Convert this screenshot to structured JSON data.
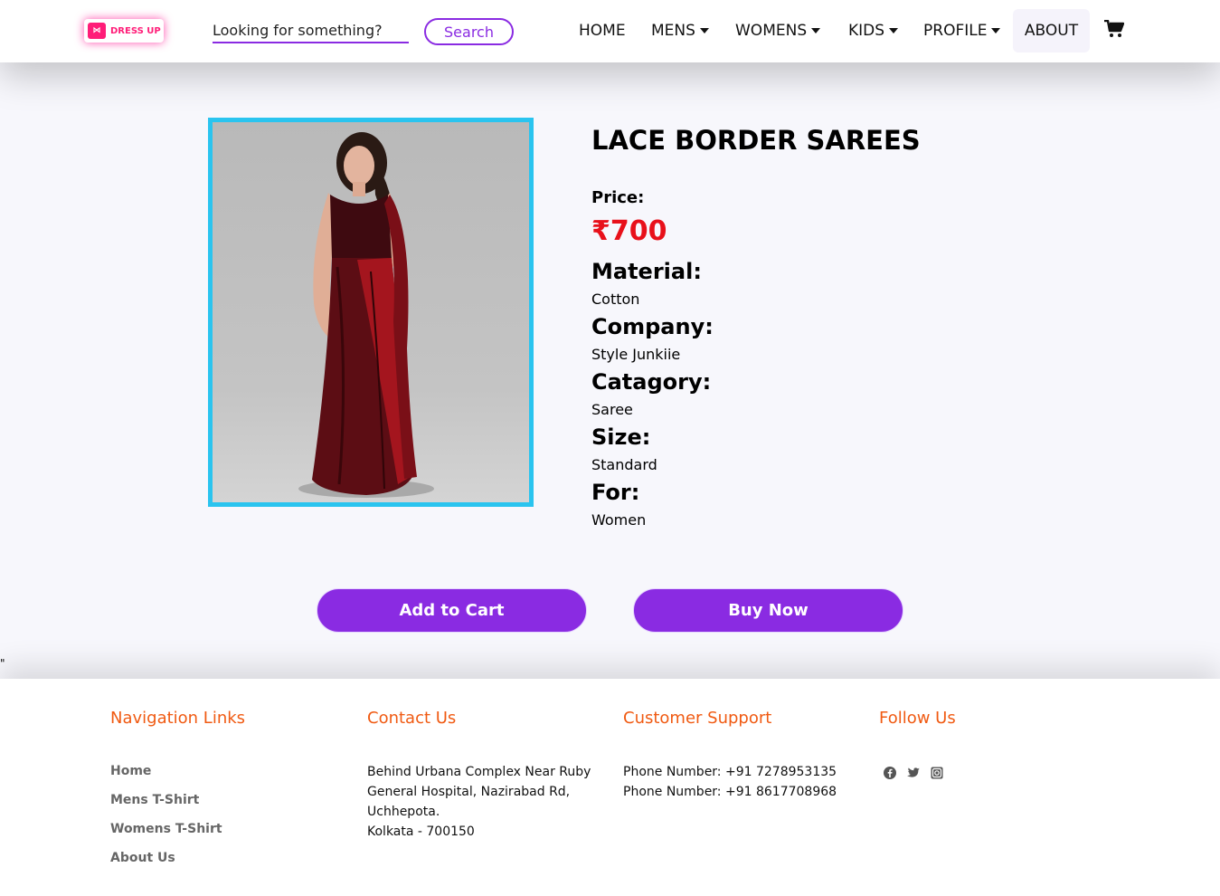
{
  "header": {
    "logo_text": "DRESS UP",
    "search_placeholder": "Looking for something?",
    "search_button": "Search",
    "nav": {
      "home": "HOME",
      "mens": "MENS",
      "womens": "WOMENS",
      "kids": "KIDS",
      "profile": "PROFILE",
      "about": "ABOUT"
    },
    "cart_icon": "shopping-cart-icon"
  },
  "product": {
    "title": "LACE BORDER SAREES",
    "price_label": "Price:",
    "price": "₹700",
    "material_label": "Material:",
    "material": "Cotton",
    "company_label": "Company:",
    "company": "Style Junkiie",
    "category_label": "Catagory:",
    "category": "Saree",
    "size_label": "Size:",
    "size": "Standard",
    "for_label": "For:",
    "for": "Women",
    "add_to_cart": "Add to Cart",
    "buy_now": "Buy Now"
  },
  "stray_text": "\"",
  "footer": {
    "nav_heading": "Navigation Links",
    "nav_links": [
      "Home",
      "Mens T-Shirt",
      "Womens T-Shirt",
      "About Us"
    ],
    "contact_heading": "Contact Us",
    "address": [
      "Behind Urbana Complex Near Ruby",
      "General Hospital, Nazirabad Rd,",
      "Uchhepota.",
      "Kolkata - 700150"
    ],
    "support_heading": "Customer Support",
    "phones": [
      "Phone Number: +91 7278953135",
      "Phone Number: +91 8617708968"
    ],
    "follow_heading": "Follow Us",
    "social_icons": [
      "facebook-icon",
      "twitter-icon",
      "instagram-icon"
    ]
  },
  "colors": {
    "accent": "#8a2be2",
    "price": "#e8101a",
    "footer_heading": "#f05a12",
    "image_border": "#2ac4ef",
    "logo": "#ff1d78"
  }
}
